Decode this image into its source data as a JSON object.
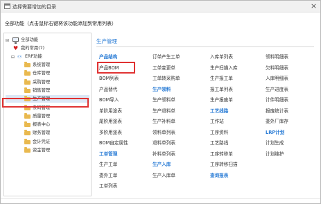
{
  "window": {
    "title": "选择需要增加的目录",
    "close_glyph": "×"
  },
  "instruction": "全部功能（点击鼠标右键将该功能添加到常用列表）",
  "tree": {
    "root_toggle": "⊟",
    "root_label": "全部功能",
    "favorites_label": "我的常用(7)",
    "erp_toggle": "⊟",
    "erp_label": "ERP功能",
    "items": [
      {
        "label": "系统管理"
      },
      {
        "label": "仓库管理"
      },
      {
        "label": "采购管理"
      },
      {
        "label": "销售管理"
      },
      {
        "label": "生产管理",
        "selected": true
      },
      {
        "label": "条码管理"
      },
      {
        "label": "质量管理"
      },
      {
        "label": "报表中心"
      },
      {
        "label": "财务管理"
      },
      {
        "label": "会计凭证"
      },
      {
        "label": "资金管理"
      }
    ]
  },
  "main": {
    "section_title": "生产管理",
    "col1": [
      {
        "label": "产品结构",
        "header": true
      },
      {
        "label": "产品BOM"
      },
      {
        "label": "BOM列表"
      },
      {
        "label": "产品替代"
      },
      {
        "label": "BOM导入"
      },
      {
        "label": "单阶用途表"
      },
      {
        "label": "尾阶用途表"
      },
      {
        "label": "多阶用途表"
      },
      {
        "label": "BOM自定属性"
      },
      {
        "label": "工单管理",
        "header": true
      },
      {
        "label": "生产工单"
      },
      {
        "label": "委外工单"
      },
      {
        "label": "工单列表"
      }
    ],
    "col2": [
      {
        "label": "订单产生工单"
      },
      {
        "label": "工单变更单"
      },
      {
        "label": "工单转采购单"
      },
      {
        "label": "生产领料",
        "header": true
      },
      {
        "label": "生产领料单"
      },
      {
        "label": "生产退料单"
      },
      {
        "label": "生产补料单"
      },
      {
        "label": "领料单列表"
      },
      {
        "label": "退料单列表"
      },
      {
        "label": "补料单列表"
      },
      {
        "label": "生产入库",
        "header": true
      },
      {
        "label": "生产入库单"
      }
    ],
    "col3": [
      {
        "label": "入库单列表"
      },
      {
        "label": "生产扫描入库"
      },
      {
        "label": "生产报工单"
      },
      {
        "label": "报工单列表"
      },
      {
        "label": "生产报废单"
      },
      {
        "label": "工艺线路",
        "header": true
      },
      {
        "label": "工作站"
      },
      {
        "label": "工序资料"
      },
      {
        "label": "工艺路线"
      },
      {
        "label": "工序转移单"
      },
      {
        "label": "工序转移扫描"
      },
      {
        "label": "查询报表",
        "header": true
      }
    ],
    "col4": [
      {
        "label": "领料明细表"
      },
      {
        "label": "欠料明细表"
      },
      {
        "label": "入库明细表"
      },
      {
        "label": "生产进度表"
      },
      {
        "label": "计件明细表"
      },
      {
        "label": "报废统计表"
      },
      {
        "label": "委外厂库存"
      },
      {
        "label": "LRP计划",
        "header": true
      },
      {
        "label": "计划生成"
      },
      {
        "label": "计划维护"
      }
    ]
  }
}
